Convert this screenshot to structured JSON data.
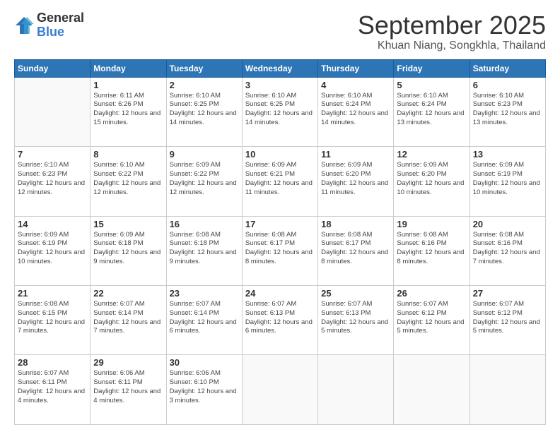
{
  "header": {
    "logo_general": "General",
    "logo_blue": "Blue",
    "month_title": "September 2025",
    "location": "Khuan Niang, Songkhla, Thailand"
  },
  "days_of_week": [
    "Sunday",
    "Monday",
    "Tuesday",
    "Wednesday",
    "Thursday",
    "Friday",
    "Saturday"
  ],
  "weeks": [
    [
      {
        "day": "",
        "sunrise": "",
        "sunset": "",
        "daylight": "",
        "empty": true
      },
      {
        "day": "1",
        "sunrise": "6:11 AM",
        "sunset": "6:26 PM",
        "daylight": "12 hours and 15 minutes."
      },
      {
        "day": "2",
        "sunrise": "6:10 AM",
        "sunset": "6:25 PM",
        "daylight": "12 hours and 14 minutes."
      },
      {
        "day": "3",
        "sunrise": "6:10 AM",
        "sunset": "6:25 PM",
        "daylight": "12 hours and 14 minutes."
      },
      {
        "day": "4",
        "sunrise": "6:10 AM",
        "sunset": "6:24 PM",
        "daylight": "12 hours and 14 minutes."
      },
      {
        "day": "5",
        "sunrise": "6:10 AM",
        "sunset": "6:24 PM",
        "daylight": "12 hours and 13 minutes."
      },
      {
        "day": "6",
        "sunrise": "6:10 AM",
        "sunset": "6:23 PM",
        "daylight": "12 hours and 13 minutes."
      }
    ],
    [
      {
        "day": "7",
        "sunrise": "6:10 AM",
        "sunset": "6:23 PM",
        "daylight": "12 hours and 12 minutes."
      },
      {
        "day": "8",
        "sunrise": "6:10 AM",
        "sunset": "6:22 PM",
        "daylight": "12 hours and 12 minutes."
      },
      {
        "day": "9",
        "sunrise": "6:09 AM",
        "sunset": "6:22 PM",
        "daylight": "12 hours and 12 minutes."
      },
      {
        "day": "10",
        "sunrise": "6:09 AM",
        "sunset": "6:21 PM",
        "daylight": "12 hours and 11 minutes."
      },
      {
        "day": "11",
        "sunrise": "6:09 AM",
        "sunset": "6:20 PM",
        "daylight": "12 hours and 11 minutes."
      },
      {
        "day": "12",
        "sunrise": "6:09 AM",
        "sunset": "6:20 PM",
        "daylight": "12 hours and 10 minutes."
      },
      {
        "day": "13",
        "sunrise": "6:09 AM",
        "sunset": "6:19 PM",
        "daylight": "12 hours and 10 minutes."
      }
    ],
    [
      {
        "day": "14",
        "sunrise": "6:09 AM",
        "sunset": "6:19 PM",
        "daylight": "12 hours and 10 minutes."
      },
      {
        "day": "15",
        "sunrise": "6:09 AM",
        "sunset": "6:18 PM",
        "daylight": "12 hours and 9 minutes."
      },
      {
        "day": "16",
        "sunrise": "6:08 AM",
        "sunset": "6:18 PM",
        "daylight": "12 hours and 9 minutes."
      },
      {
        "day": "17",
        "sunrise": "6:08 AM",
        "sunset": "6:17 PM",
        "daylight": "12 hours and 8 minutes."
      },
      {
        "day": "18",
        "sunrise": "6:08 AM",
        "sunset": "6:17 PM",
        "daylight": "12 hours and 8 minutes."
      },
      {
        "day": "19",
        "sunrise": "6:08 AM",
        "sunset": "6:16 PM",
        "daylight": "12 hours and 8 minutes."
      },
      {
        "day": "20",
        "sunrise": "6:08 AM",
        "sunset": "6:16 PM",
        "daylight": "12 hours and 7 minutes."
      }
    ],
    [
      {
        "day": "21",
        "sunrise": "6:08 AM",
        "sunset": "6:15 PM",
        "daylight": "12 hours and 7 minutes."
      },
      {
        "day": "22",
        "sunrise": "6:07 AM",
        "sunset": "6:14 PM",
        "daylight": "12 hours and 7 minutes."
      },
      {
        "day": "23",
        "sunrise": "6:07 AM",
        "sunset": "6:14 PM",
        "daylight": "12 hours and 6 minutes."
      },
      {
        "day": "24",
        "sunrise": "6:07 AM",
        "sunset": "6:13 PM",
        "daylight": "12 hours and 6 minutes."
      },
      {
        "day": "25",
        "sunrise": "6:07 AM",
        "sunset": "6:13 PM",
        "daylight": "12 hours and 5 minutes."
      },
      {
        "day": "26",
        "sunrise": "6:07 AM",
        "sunset": "6:12 PM",
        "daylight": "12 hours and 5 minutes."
      },
      {
        "day": "27",
        "sunrise": "6:07 AM",
        "sunset": "6:12 PM",
        "daylight": "12 hours and 5 minutes."
      }
    ],
    [
      {
        "day": "28",
        "sunrise": "6:07 AM",
        "sunset": "6:11 PM",
        "daylight": "12 hours and 4 minutes."
      },
      {
        "day": "29",
        "sunrise": "6:06 AM",
        "sunset": "6:11 PM",
        "daylight": "12 hours and 4 minutes."
      },
      {
        "day": "30",
        "sunrise": "6:06 AM",
        "sunset": "6:10 PM",
        "daylight": "12 hours and 3 minutes."
      },
      {
        "day": "",
        "sunrise": "",
        "sunset": "",
        "daylight": "",
        "empty": true
      },
      {
        "day": "",
        "sunrise": "",
        "sunset": "",
        "daylight": "",
        "empty": true
      },
      {
        "day": "",
        "sunrise": "",
        "sunset": "",
        "daylight": "",
        "empty": true
      },
      {
        "day": "",
        "sunrise": "",
        "sunset": "",
        "daylight": "",
        "empty": true
      }
    ]
  ]
}
